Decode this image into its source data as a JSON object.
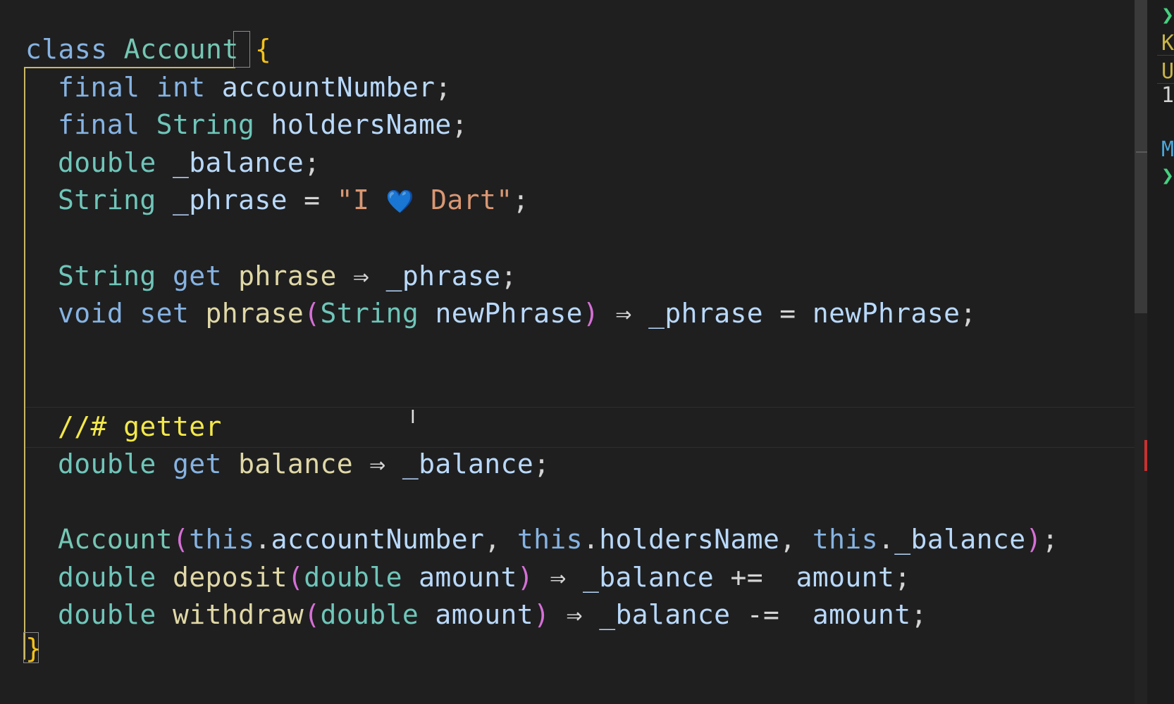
{
  "editor": {
    "lines": [
      [
        {
          "t": "class",
          "c": "kw"
        },
        {
          "t": " "
        },
        {
          "t": "Account",
          "c": "cls"
        },
        {
          "t": " "
        },
        {
          "t": "{",
          "c": "brY"
        }
      ],
      [
        {
          "t": "final",
          "c": "kw"
        },
        {
          "t": " "
        },
        {
          "t": "int",
          "c": "kw"
        },
        {
          "t": " "
        },
        {
          "t": "accountNumber",
          "c": "var"
        },
        {
          "t": ";",
          "c": "pn"
        }
      ],
      [
        {
          "t": "final",
          "c": "kw"
        },
        {
          "t": " "
        },
        {
          "t": "String",
          "c": "ty"
        },
        {
          "t": " "
        },
        {
          "t": "holdersName",
          "c": "var"
        },
        {
          "t": ";",
          "c": "pn"
        }
      ],
      [
        {
          "t": "double",
          "c": "ty"
        },
        {
          "t": " "
        },
        {
          "t": "_balance",
          "c": "var"
        },
        {
          "t": ";",
          "c": "pn"
        }
      ],
      [
        {
          "t": "String",
          "c": "ty"
        },
        {
          "t": " "
        },
        {
          "t": "_phrase",
          "c": "var"
        },
        {
          "t": " = ",
          "c": "op"
        },
        {
          "t": "\"I ",
          "c": "str"
        },
        {
          "t": "💙",
          "c": "heart"
        },
        {
          "t": " Dart\"",
          "c": "str"
        },
        {
          "t": ";",
          "c": "pn"
        }
      ],
      [],
      [
        {
          "t": "String",
          "c": "ty"
        },
        {
          "t": " "
        },
        {
          "t": "get",
          "c": "kw"
        },
        {
          "t": " "
        },
        {
          "t": "phrase",
          "c": "fn"
        },
        {
          "t": " ⇒ ",
          "c": "op"
        },
        {
          "t": "_phrase",
          "c": "var"
        },
        {
          "t": ";",
          "c": "pn"
        }
      ],
      [
        {
          "t": "void",
          "c": "kw"
        },
        {
          "t": " "
        },
        {
          "t": "set",
          "c": "kw"
        },
        {
          "t": " "
        },
        {
          "t": "phrase",
          "c": "fn"
        },
        {
          "t": "(",
          "c": "brP"
        },
        {
          "t": "String",
          "c": "ty"
        },
        {
          "t": " "
        },
        {
          "t": "newPhrase",
          "c": "var"
        },
        {
          "t": ")",
          "c": "brP"
        },
        {
          "t": " ⇒ ",
          "c": "op"
        },
        {
          "t": "_phrase",
          "c": "var"
        },
        {
          "t": " = ",
          "c": "op"
        },
        {
          "t": "newPhrase",
          "c": "var"
        },
        {
          "t": ";",
          "c": "pn"
        }
      ],
      [],
      [],
      [
        {
          "t": "//# getter",
          "c": "com"
        }
      ],
      [
        {
          "t": "double",
          "c": "ty"
        },
        {
          "t": " "
        },
        {
          "t": "get",
          "c": "kw"
        },
        {
          "t": " "
        },
        {
          "t": "balance",
          "c": "fn"
        },
        {
          "t": " ⇒ ",
          "c": "op"
        },
        {
          "t": "_balance",
          "c": "var"
        },
        {
          "t": ";",
          "c": "pn"
        }
      ],
      [],
      [
        {
          "t": "Account",
          "c": "cls"
        },
        {
          "t": "(",
          "c": "brP"
        },
        {
          "t": "this",
          "c": "kw"
        },
        {
          "t": ".",
          "c": "pn"
        },
        {
          "t": "accountNumber",
          "c": "var"
        },
        {
          "t": ", ",
          "c": "pn"
        },
        {
          "t": "this",
          "c": "kw"
        },
        {
          "t": ".",
          "c": "pn"
        },
        {
          "t": "holdersName",
          "c": "var"
        },
        {
          "t": ", ",
          "c": "pn"
        },
        {
          "t": "this",
          "c": "kw"
        },
        {
          "t": ".",
          "c": "pn"
        },
        {
          "t": "_balance",
          "c": "var"
        },
        {
          "t": ")",
          "c": "brP"
        },
        {
          "t": ";",
          "c": "pn"
        }
      ],
      [
        {
          "t": "double",
          "c": "ty"
        },
        {
          "t": " "
        },
        {
          "t": "deposit",
          "c": "fn"
        },
        {
          "t": "(",
          "c": "brP"
        },
        {
          "t": "double",
          "c": "ty"
        },
        {
          "t": " "
        },
        {
          "t": "amount",
          "c": "var"
        },
        {
          "t": ")",
          "c": "brP"
        },
        {
          "t": " ⇒ ",
          "c": "op"
        },
        {
          "t": "_balance",
          "c": "var"
        },
        {
          "t": " +=  ",
          "c": "op"
        },
        {
          "t": "amount",
          "c": "var"
        },
        {
          "t": ";",
          "c": "pn"
        }
      ],
      [
        {
          "t": "double",
          "c": "ty"
        },
        {
          "t": " "
        },
        {
          "t": "withdraw",
          "c": "fn"
        },
        {
          "t": "(",
          "c": "brP"
        },
        {
          "t": "double",
          "c": "ty"
        },
        {
          "t": " "
        },
        {
          "t": "amount",
          "c": "var"
        },
        {
          "t": ")",
          "c": "brP"
        },
        {
          "t": " ⇒ ",
          "c": "op"
        },
        {
          "t": "_balance",
          "c": "var"
        },
        {
          "t": " -=  ",
          "c": "op"
        },
        {
          "t": "amount",
          "c": "var"
        },
        {
          "t": ";",
          "c": "pn"
        }
      ],
      [
        {
          "t": "}",
          "c": "brY"
        }
      ]
    ]
  },
  "side_panel": {
    "items": [
      {
        "text": "❯",
        "c": "sp-green"
      },
      {
        "text": "K",
        "c": "sp-yellow"
      },
      {
        "text": "U",
        "c": "sp-yellow"
      },
      {
        "text": "1",
        "c": "sp-white"
      },
      {
        "text": "M",
        "c": "sp-blue"
      },
      {
        "text": "❯",
        "c": "sp-green"
      }
    ]
  },
  "colors": {
    "background": "#1f1f20",
    "keyword": "#86b3e2",
    "type": "#6fc6b9",
    "function": "#e0d8a6",
    "string": "#d99773",
    "comment": "#f3e84a",
    "bracket_outer": "#f3c21a",
    "bracket_inner": "#d670d6"
  }
}
